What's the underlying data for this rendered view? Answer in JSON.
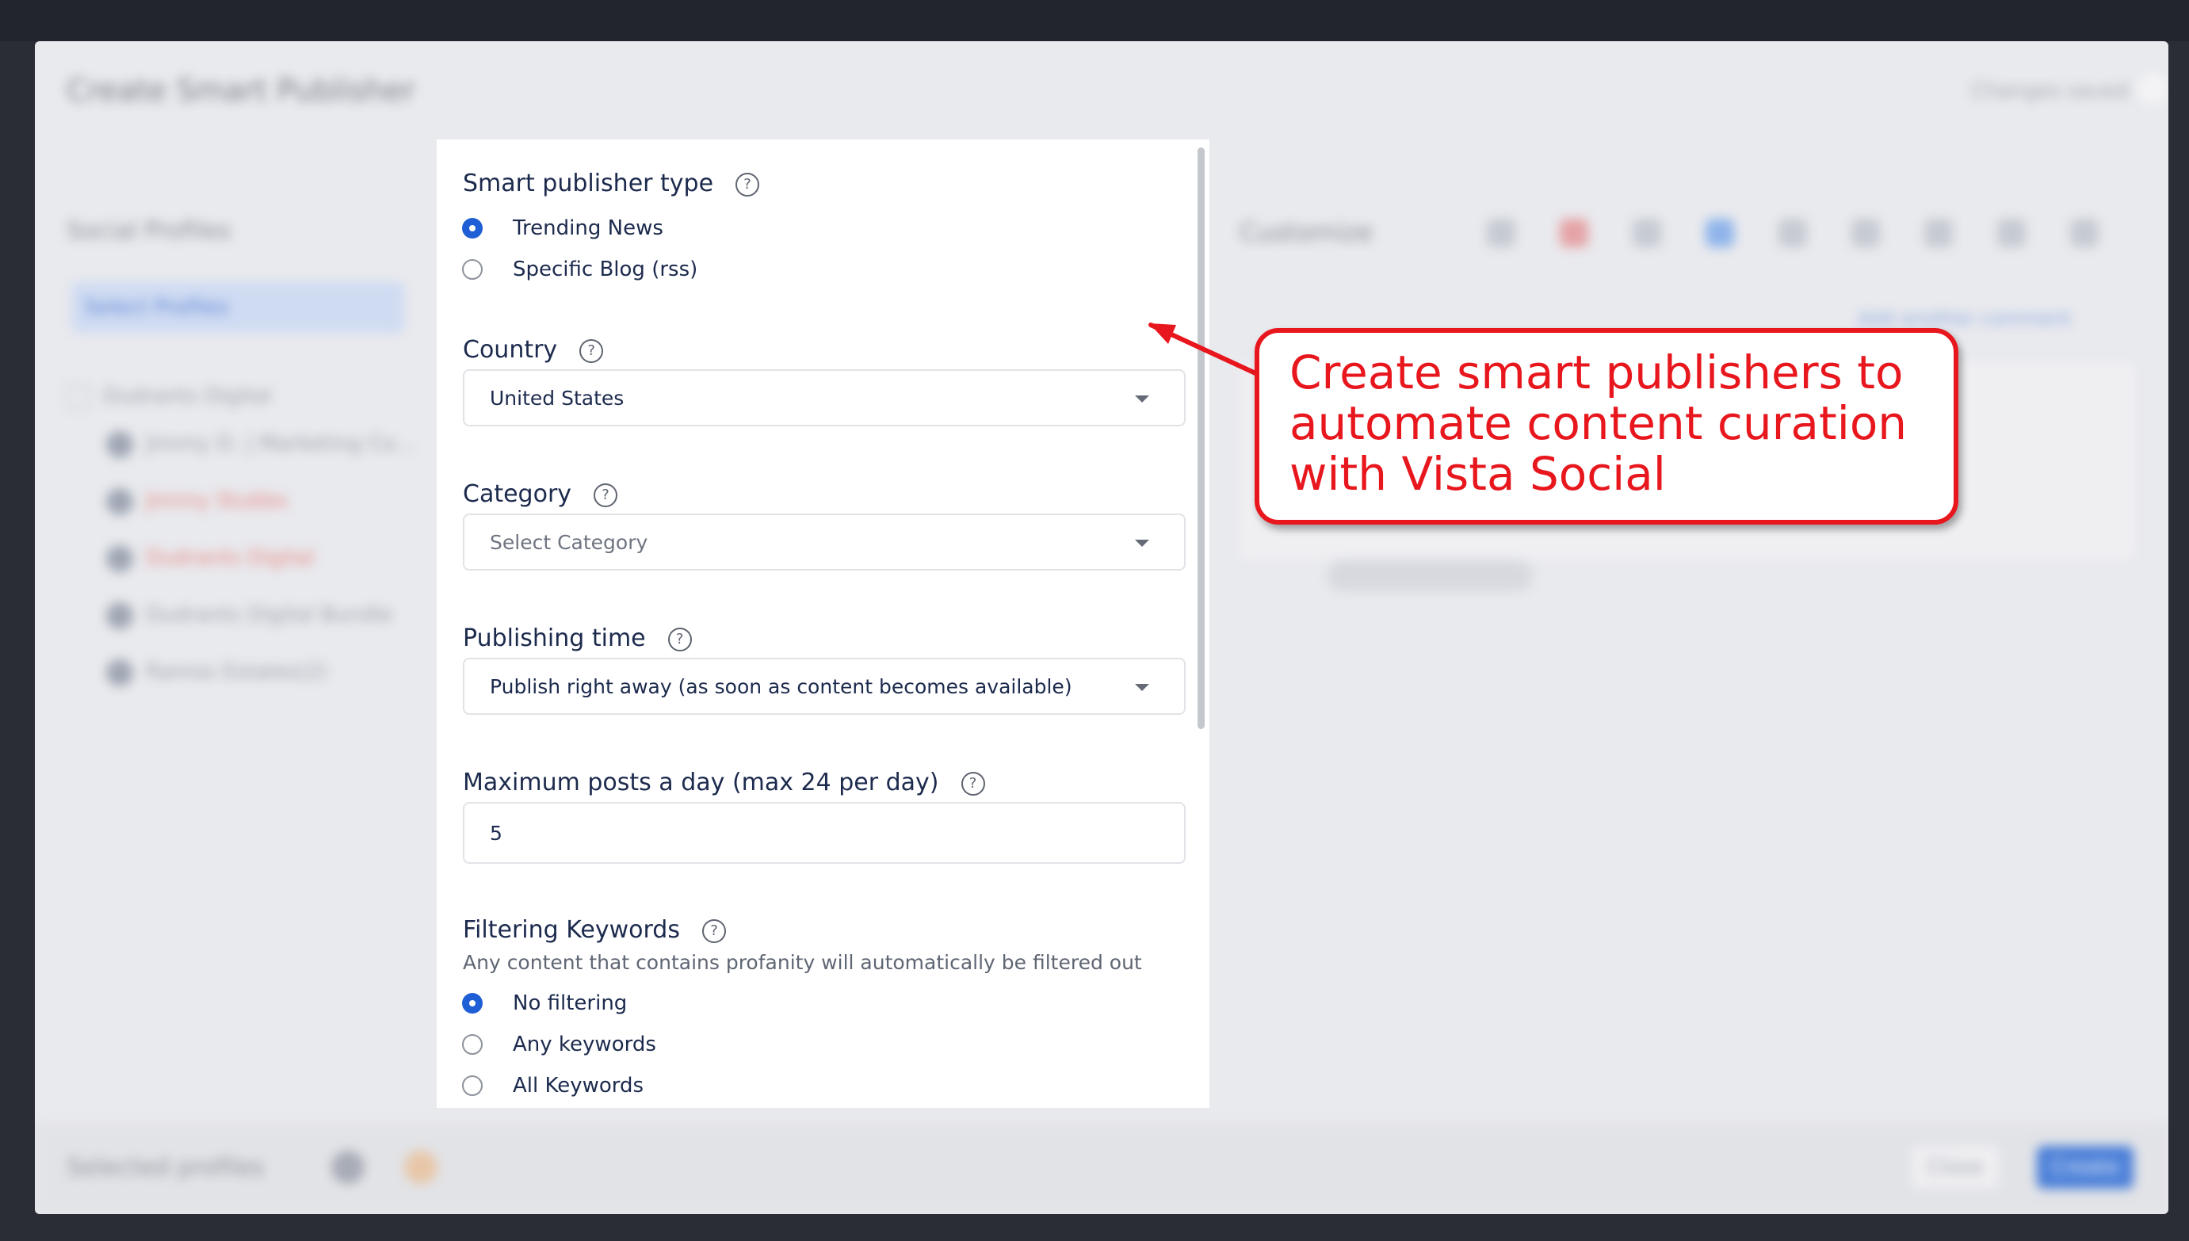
{
  "modal": {
    "title": "Create Smart Publisher",
    "status": "Changes saved"
  },
  "left_pane": {
    "section_label": "Social Profiles",
    "select_profiles": "Select Profiles",
    "profile_group": "Dudrants Digital",
    "profiles": [
      "Jimmy D. | Marketing Co...",
      "Jimmy Stubbs",
      "Dudrants Digital",
      "Dudrants Digital Bundle",
      "Ramos Estates(2)"
    ]
  },
  "right_pane": {
    "customize_label": "Customize",
    "add_comment": "Add another comment"
  },
  "form": {
    "publisher_type": {
      "label": "Smart publisher type",
      "options": [
        "Trending News",
        "Specific Blog (rss)"
      ],
      "selected": "Trending News"
    },
    "country": {
      "label": "Country",
      "value": "United States"
    },
    "category": {
      "label": "Category",
      "placeholder": "Select Category"
    },
    "publishing_time": {
      "label": "Publishing time",
      "value": "Publish right away (as soon as content becomes available)"
    },
    "max_posts": {
      "label": "Maximum posts a day (max 24 per day)",
      "value": "5"
    },
    "filtering": {
      "label": "Filtering Keywords",
      "hint": "Any content that contains profanity will automatically be filtered out",
      "options": [
        "No filtering",
        "Any keywords",
        "All Keywords"
      ],
      "selected": "No filtering"
    },
    "help_glyph": "?"
  },
  "footer": {
    "selected_profiles": "Selected profiles",
    "close_label": "Close",
    "create_label": "Create"
  },
  "callout": {
    "text": "Create smart publishers to automate content curation with Vista Social",
    "color": "#e8161d"
  },
  "colors": {
    "accent": "#1f5fd6",
    "label_text": "#1c2a4d"
  }
}
